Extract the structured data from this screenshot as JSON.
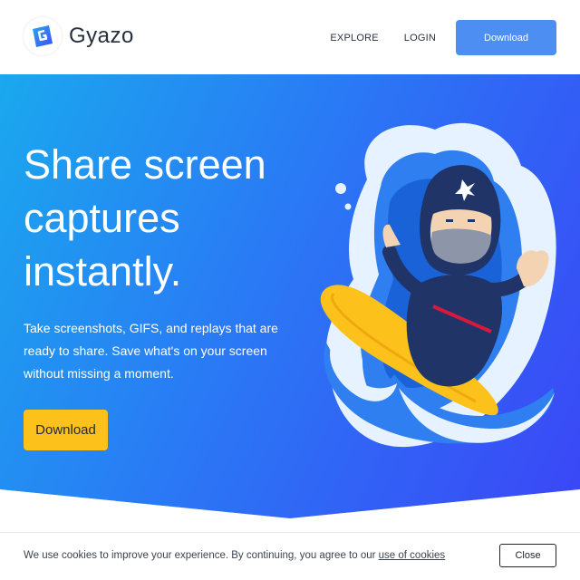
{
  "header": {
    "brand": "Gyazo",
    "nav": {
      "explore": "EXPLORE",
      "login": "LOGIN",
      "download": "Download"
    }
  },
  "hero": {
    "headline": "Share screen captures instantly.",
    "subtext": "Take screenshots, GIFS, and replays that are ready to share. Save what's on your screen without missing a moment.",
    "download": "Download"
  },
  "cookie": {
    "text": "We use cookies to improve your experience. By continuing, you agree to our",
    "link": "use of cookies",
    "close": "Close"
  },
  "colors": {
    "brand_blue": "#4c8ef1",
    "hero_start": "#1aa8ee",
    "hero_end": "#3b46f6",
    "cta_yellow": "#fcc21b"
  },
  "icons": {
    "logo": "gyazo-logo-icon",
    "illustration": "ninja-surfer-illustration"
  }
}
